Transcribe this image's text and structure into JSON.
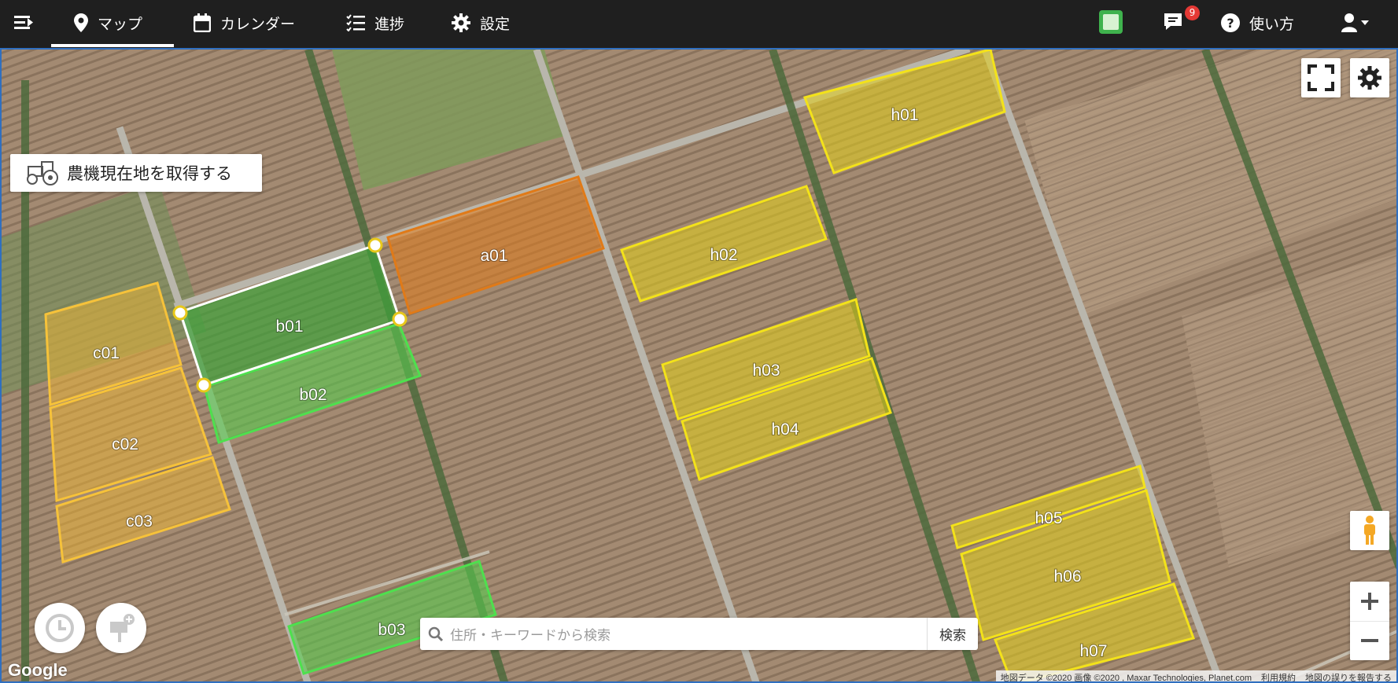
{
  "nav": {
    "items": [
      {
        "label": "マップ",
        "icon": "map-marker-icon"
      },
      {
        "label": "カレンダー",
        "icon": "calendar-icon"
      },
      {
        "label": "進捗",
        "icon": "checklist-icon"
      },
      {
        "label": "設定",
        "icon": "gear-icon"
      }
    ],
    "active_index": 0,
    "notification_count": "9",
    "help_label": "使い方"
  },
  "map": {
    "tractor_button_label": "農機現在地を取得する",
    "search_placeholder": "住所・キーワードから検索",
    "search_button_label": "検索",
    "google_logo": "Google",
    "attribution": {
      "data": "地図データ ©2020 画像 ©2020 , Maxar Technologies, Planet.com",
      "terms": "利用規約",
      "report": "地図の誤りを報告する"
    },
    "colors": {
      "yellow": "#e8d21a",
      "orange": "#e07a18",
      "green": "#4ed24e",
      "selected_outline": "#ffffff",
      "light_orange": "#f0b632"
    },
    "fields": [
      {
        "name": "h01",
        "status": "yellow"
      },
      {
        "name": "h02",
        "status": "yellow"
      },
      {
        "name": "h03",
        "status": "yellow"
      },
      {
        "name": "h04",
        "status": "yellow"
      },
      {
        "name": "h05",
        "status": "yellow"
      },
      {
        "name": "h06",
        "status": "yellow"
      },
      {
        "name": "h07",
        "status": "yellow"
      },
      {
        "name": "a01",
        "status": "orange"
      },
      {
        "name": "b01",
        "status": "selected"
      },
      {
        "name": "b02",
        "status": "green"
      },
      {
        "name": "b03",
        "status": "green"
      },
      {
        "name": "c01",
        "status": "light_orange"
      },
      {
        "name": "c02",
        "status": "light_orange"
      },
      {
        "name": "c03",
        "status": "light_orange"
      }
    ]
  }
}
